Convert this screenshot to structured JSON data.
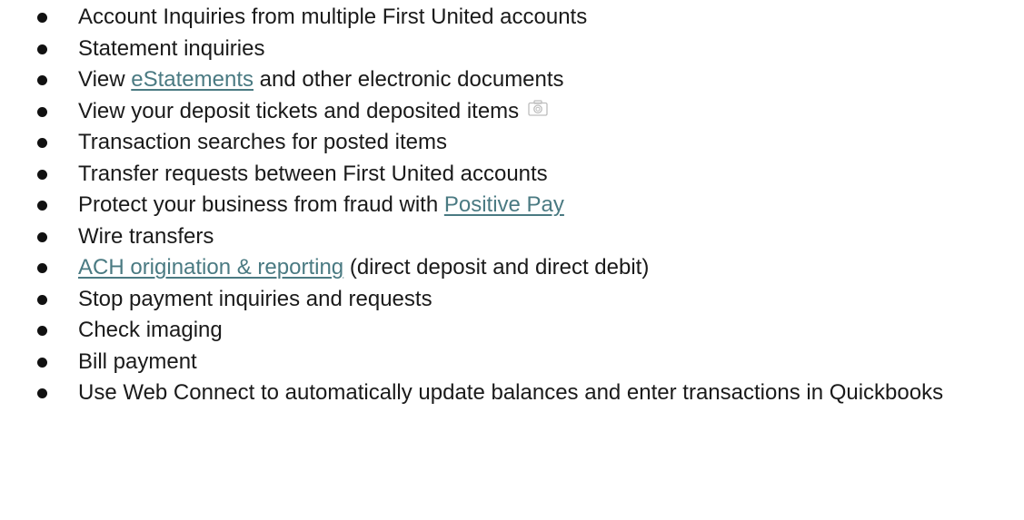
{
  "colors": {
    "text": "#1a1a1a",
    "link": "#4a7a82",
    "bullet": "#111111",
    "icon": "#bdbdbd"
  },
  "items": [
    {
      "text": "Account Inquiries from multiple First United accounts"
    },
    {
      "text": "Statement inquiries"
    },
    {
      "before": "View ",
      "link": "eStatements",
      "after": " and other electronic documents"
    },
    {
      "text": "View your deposit tickets and deposited items",
      "icon": "camera-icon"
    },
    {
      "text": "Transaction searches for posted items"
    },
    {
      "text": "Transfer requests between First United accounts"
    },
    {
      "before": "Protect your business from fraud with ",
      "link": "Positive Pay",
      "after": ""
    },
    {
      "text": "Wire transfers"
    },
    {
      "before": "",
      "link": "ACH origination & reporting",
      "after": " (direct deposit and direct debit)"
    },
    {
      "text": "Stop payment inquiries and requests"
    },
    {
      "text": "Check imaging"
    },
    {
      "text": "Bill payment"
    },
    {
      "text": "Use Web Connect to automatically update balances and enter transactions in Quickbooks"
    }
  ]
}
